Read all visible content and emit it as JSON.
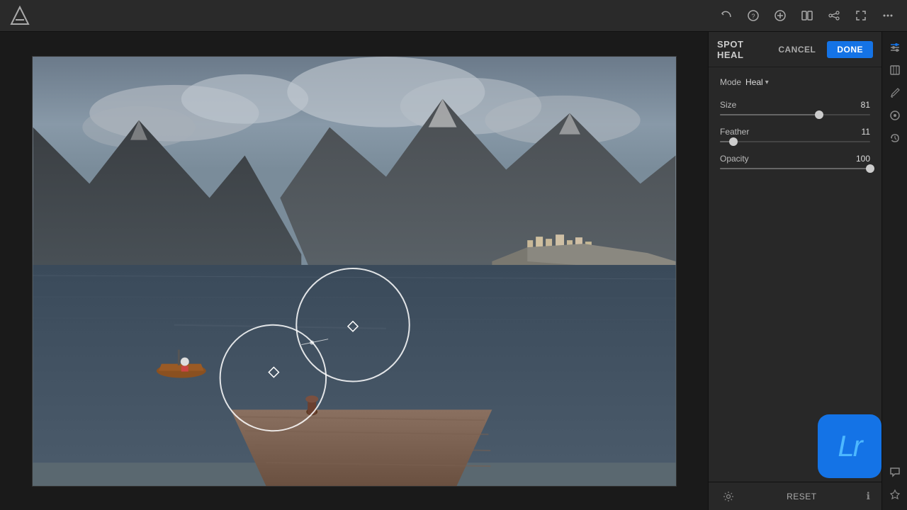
{
  "app": {
    "title": "Adobe Lightroom"
  },
  "toolbar": {
    "icons": [
      "undo",
      "help",
      "add",
      "split-view",
      "share",
      "expand",
      "more"
    ]
  },
  "panel": {
    "title": "SPOT HEAL",
    "cancel_label": "CANCEL",
    "done_label": "DONE",
    "mode_label": "Mode",
    "mode_value": "Heal",
    "size_label": "Size",
    "size_value": "81",
    "size_percent": 66,
    "feather_label": "Feather",
    "feather_value": "11",
    "feather_percent": 9,
    "opacity_label": "Opacity",
    "opacity_value": "100",
    "opacity_percent": 100
  },
  "bottom": {
    "reset_label": "RESET"
  },
  "right_icons": [
    "heal-tool",
    "crop-tool",
    "brush-tool",
    "fx-tool",
    "history-tool",
    "comment-icon",
    "star-icon",
    "info-icon"
  ],
  "lr_badge": {
    "text": "Lr"
  }
}
